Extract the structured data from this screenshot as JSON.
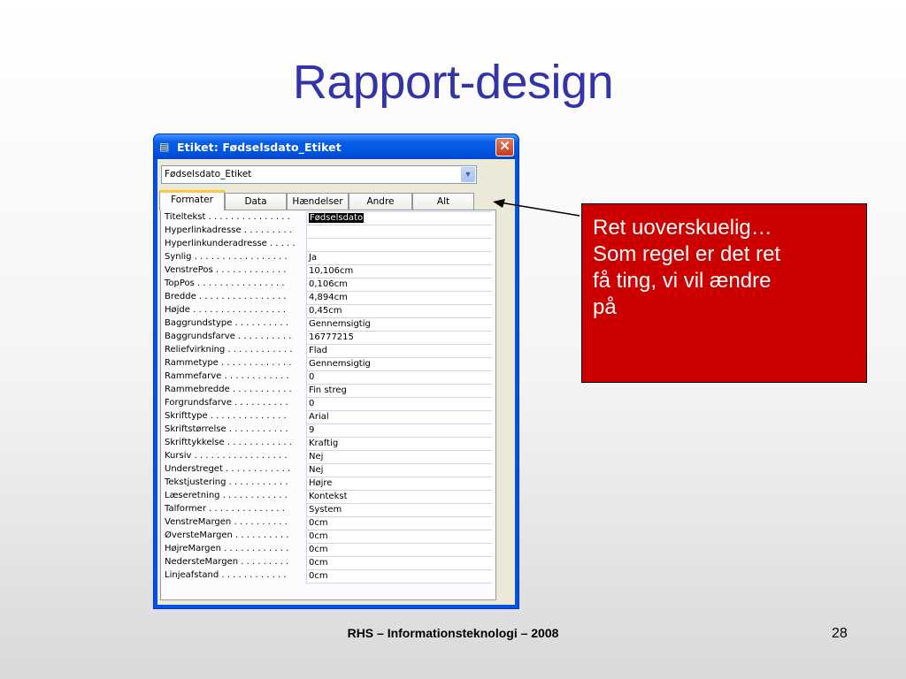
{
  "slide": {
    "title": "Rapport-design",
    "footer": "RHS – Informationsteknologi – 2008",
    "page_number": "28"
  },
  "window": {
    "title": "Etiket: Fødselsdato_Etiket",
    "icon": "properties-icon",
    "close": "✕",
    "combo_value": "Fødselsdato_Etiket",
    "tabs": [
      "Formater",
      "Data",
      "Hændelser",
      "Andre",
      "Alt"
    ],
    "active_tab": "Formater",
    "properties": [
      {
        "label": "Titeltekst . . . . . . . . . . . . . . .",
        "value": "Fødselsdato"
      },
      {
        "label": "Hyperlinkadresse . . . . . . . . .",
        "value": ""
      },
      {
        "label": "Hyperlinkunderadresse . . . . .",
        "value": ""
      },
      {
        "label": "Synlig . . . . . . . . . . . . . . . . .",
        "value": "Ja"
      },
      {
        "label": "VenstrePos . . . . . . . . . . . . .",
        "value": "10,106cm"
      },
      {
        "label": "TopPos . . . . . . . . . . . . . . . .",
        "value": "0,106cm"
      },
      {
        "label": "Bredde . . . . . . . . . . . . . . . .",
        "value": "4,894cm"
      },
      {
        "label": "Højde . . . . . . . . . . . . . . . . .",
        "value": "0,45cm"
      },
      {
        "label": "Baggrundstype . . . . . . . . . .",
        "value": "Gennemsigtig"
      },
      {
        "label": "Baggrundsfarve . . . . . . . . . .",
        "value": "16777215"
      },
      {
        "label": "Reliefvirkning . . . . . . . . . . . .",
        "value": "Flad"
      },
      {
        "label": "Rammetype . . . . . . . . . . . . .",
        "value": "Gennemsigtig"
      },
      {
        "label": "Rammefarve . . . . . . . . . . . .",
        "value": "0"
      },
      {
        "label": "Rammebredde . . . . . . . . . . .",
        "value": "Fin streg"
      },
      {
        "label": "Forgrundsfarve . . . . . . . . . .",
        "value": "0"
      },
      {
        "label": "Skrifttype . . . . . . . . . . . . . .",
        "value": "Arial"
      },
      {
        "label": "Skriftstørrelse . . . . . . . . . . .",
        "value": "9"
      },
      {
        "label": "Skrifttykkelse . . . . . . . . . . . .",
        "value": "Kraftig"
      },
      {
        "label": "Kursiv . . . . . . . . . . . . . . . . .",
        "value": "Nej"
      },
      {
        "label": "Understreget . . . . . . . . . . . .",
        "value": "Nej"
      },
      {
        "label": "Tekstjustering . . . . . . . . . . .",
        "value": "Højre"
      },
      {
        "label": "Læseretning . . . . . . . . . . . .",
        "value": "Kontekst"
      },
      {
        "label": "Talformer . . . . . . . . . . . . . .",
        "value": "System"
      },
      {
        "label": "VenstreMargen . . . . . . . . . .",
        "value": "0cm"
      },
      {
        "label": "ØversteMargen . . . . . . . . . .",
        "value": "0cm"
      },
      {
        "label": "HøjreMargen . . . . . . . . . . . .",
        "value": "0cm"
      },
      {
        "label": "NedersteMargen . . . . . . . . .",
        "value": "0cm"
      },
      {
        "label": "Linjeafstand . . . . . . . . . . . .",
        "value": "0cm"
      }
    ]
  },
  "callout": {
    "lines": [
      "Ret uoverskuelig…",
      "Som regel er det ret",
      "få ting, vi vil ændre",
      "på"
    ],
    "color": "#cc0000"
  }
}
